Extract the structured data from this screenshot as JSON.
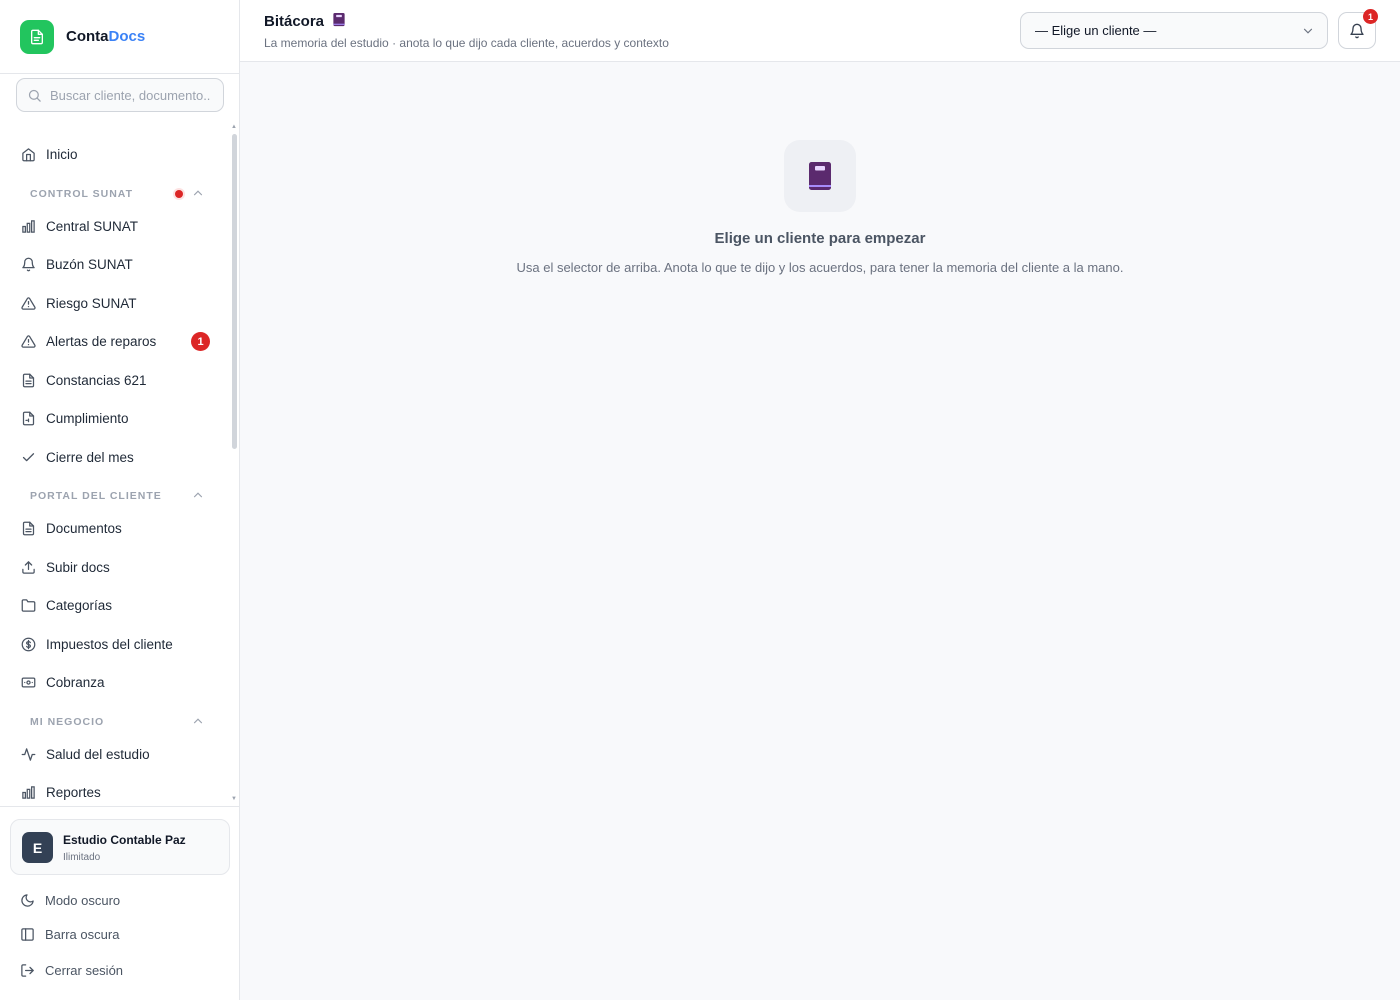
{
  "brand": {
    "name_part1": "Conta",
    "name_part2": "Docs"
  },
  "search": {
    "placeholder": "Buscar cliente, documento..."
  },
  "nav": {
    "inicio": "Inicio",
    "sections": {
      "control_sunat": "CONTROL SUNAT",
      "portal_cliente": "PORTAL DEL CLIENTE",
      "mi_negocio": "MI NEGOCIO"
    },
    "items": {
      "central_sunat": "Central SUNAT",
      "buzon_sunat": "Buzón SUNAT",
      "riesgo_sunat": "Riesgo SUNAT",
      "alertas_reparos": "Alertas de reparos",
      "alertas_badge": "1",
      "constancias": "Constancias 621",
      "cumplimiento": "Cumplimiento",
      "cierre": "Cierre del mes",
      "documentos": "Documentos",
      "subir_docs": "Subir docs",
      "categorias": "Categorías",
      "impuestos": "Impuestos del cliente",
      "cobranza": "Cobranza",
      "salud": "Salud del estudio",
      "reportes": "Reportes"
    }
  },
  "account": {
    "initial": "E",
    "name": "Estudio Contable Paz",
    "plan": "Ilimitado"
  },
  "bottom": {
    "modo_oscuro": "Modo oscuro",
    "barra_oscura": "Barra oscura",
    "cerrar_sesion": "Cerrar sesión"
  },
  "header": {
    "title": "Bitácora",
    "subtitle": "La memoria del estudio · anota lo que dijo cada cliente, acuerdos y contexto",
    "client_select": "— Elige un cliente —",
    "notif_badge": "1"
  },
  "empty": {
    "title": "Elige un cliente para empezar",
    "description": "Usa el selector de arriba. Anota lo que te dijo y los acuerdos, para tener la memoria del cliente a la mano."
  },
  "colors": {
    "brand_green": "#22c55e",
    "brand_blue": "#3b82f6",
    "alert_red": "#dc2626",
    "book_purple": "#5b2a6e"
  },
  "icons": [
    "file-icon",
    "search-icon",
    "home-icon",
    "bar-chart-icon",
    "bell-icon",
    "warning-icon",
    "document-icon",
    "check-icon",
    "upload-icon",
    "folder-icon",
    "dollar-icon",
    "card-icon",
    "activity-icon",
    "moon-icon",
    "sidebar-icon",
    "logout-icon",
    "chevron-up-icon",
    "chevron-down-icon",
    "book-icon"
  ]
}
